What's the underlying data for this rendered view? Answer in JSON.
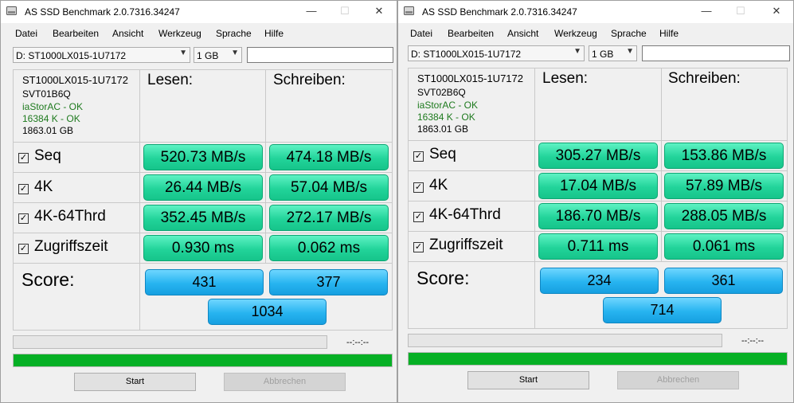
{
  "windows": [
    {
      "title": "AS SSD Benchmark 2.0.7316.34247",
      "controls": {
        "minimize": "—",
        "maximize": "☐",
        "close": "✕"
      },
      "menu": [
        "Datei",
        "Bearbeiten",
        "Ansicht",
        "Werkzeug",
        "Sprache",
        "Hilfe"
      ],
      "drive_select": "D: ST1000LX015-1U7172",
      "size_select": "1 GB",
      "drive_info": {
        "model": "ST1000LX015-1U7172",
        "firmware": "SVT01B6Q",
        "driver": "iaStorAC - OK",
        "alignment": "16384 K - OK",
        "capacity": "1863.01 GB"
      },
      "headers": {
        "read": "Lesen:",
        "write": "Schreiben:"
      },
      "rows": [
        {
          "label": "Seq",
          "read": "520.73 MB/s",
          "write": "474.18 MB/s"
        },
        {
          "label": "4K",
          "read": "26.44 MB/s",
          "write": "57.04 MB/s"
        },
        {
          "label": "4K-64Thrd",
          "read": "352.45 MB/s",
          "write": "272.17 MB/s"
        },
        {
          "label": "Zugriffszeit",
          "read": "0.930 ms",
          "write": "0.062 ms"
        }
      ],
      "score": {
        "label": "Score:",
        "read": "431",
        "write": "377",
        "total": "1034"
      },
      "time_display": "--:--:--",
      "progress_bar_2_fraction": 1.0,
      "buttons": {
        "start": "Start",
        "cancel": "Abbrechen"
      }
    },
    {
      "title": "AS SSD Benchmark 2.0.7316.34247",
      "controls": {
        "minimize": "—",
        "maximize": "☐",
        "close": "✕"
      },
      "menu": [
        "Datei",
        "Bearbeiten",
        "Ansicht",
        "Werkzeug",
        "Sprache",
        "Hilfe"
      ],
      "drive_select": "D: ST1000LX015-1U7172",
      "size_select": "1 GB",
      "drive_info": {
        "model": "ST1000LX015-1U7172",
        "firmware": "SVT02B6Q",
        "driver": "iaStorAC - OK",
        "alignment": "16384 K - OK",
        "capacity": "1863.01 GB"
      },
      "headers": {
        "read": "Lesen:",
        "write": "Schreiben:"
      },
      "rows": [
        {
          "label": "Seq",
          "read": "305.27 MB/s",
          "write": "153.86 MB/s"
        },
        {
          "label": "4K",
          "read": "17.04 MB/s",
          "write": "57.89 MB/s"
        },
        {
          "label": "4K-64Thrd",
          "read": "186.70 MB/s",
          "write": "288.05 MB/s"
        },
        {
          "label": "Zugriffszeit",
          "read": "0.711 ms",
          "write": "0.061 ms"
        }
      ],
      "score": {
        "label": "Score:",
        "read": "234",
        "write": "361",
        "total": "714"
      },
      "time_display": "--:--:--",
      "progress_bar_2_fraction": 1.0,
      "buttons": {
        "start": "Start",
        "cancel": "Abbrechen"
      }
    }
  ],
  "colors": {
    "value_green": "#22d49a",
    "score_blue": "#27b4f0",
    "progress_green": "#06b025",
    "status_ok": "#1e7a1e"
  }
}
